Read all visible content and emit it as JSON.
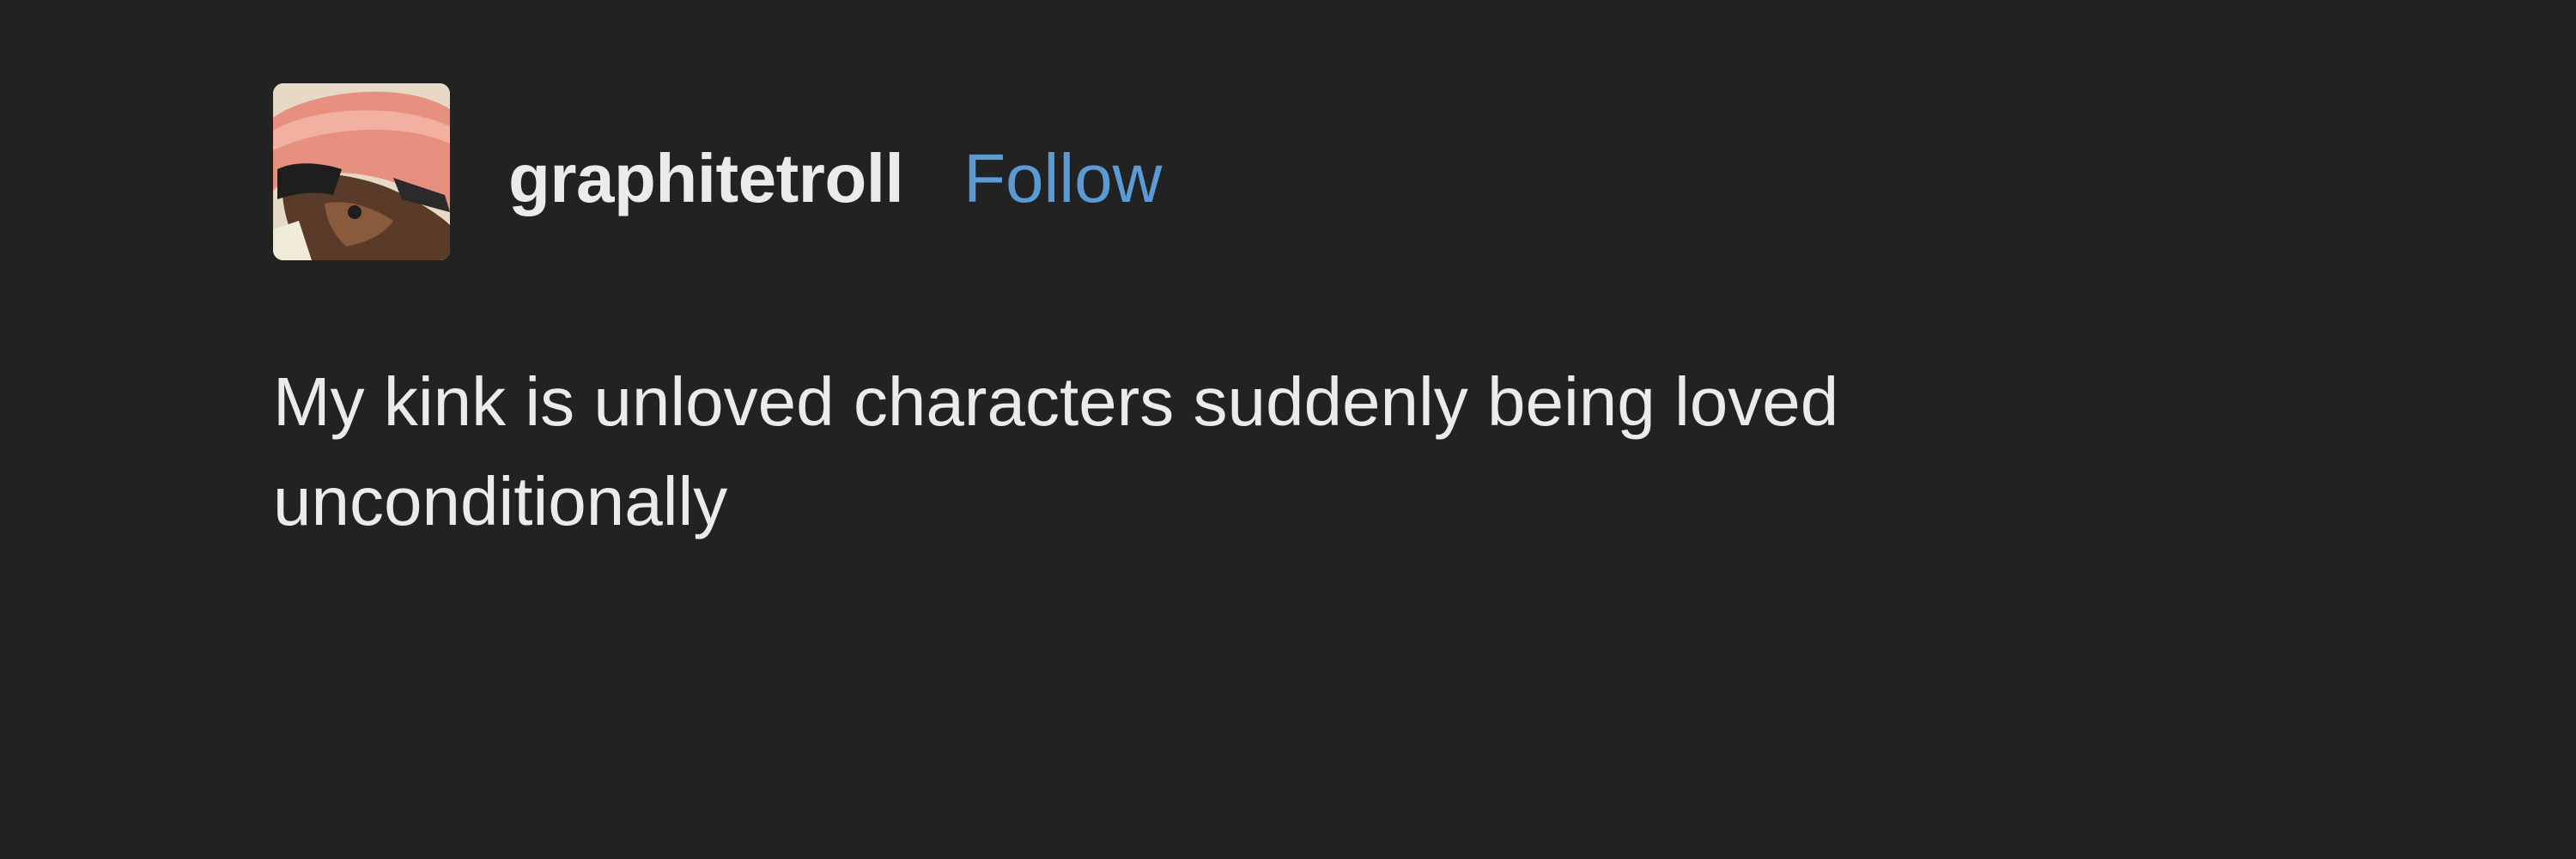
{
  "post": {
    "author": {
      "username": "graphitetroll",
      "avatar_icon": "avatar-image",
      "follow_label": "Follow"
    },
    "body": {
      "line1": "My kink is unloved characters suddenly being loved",
      "line2": "unconditionally"
    }
  },
  "colors": {
    "background": "#222222",
    "text": "#ebebeb",
    "follow_link": "#5b9bd5",
    "avatar_hat": "#e8907f"
  }
}
